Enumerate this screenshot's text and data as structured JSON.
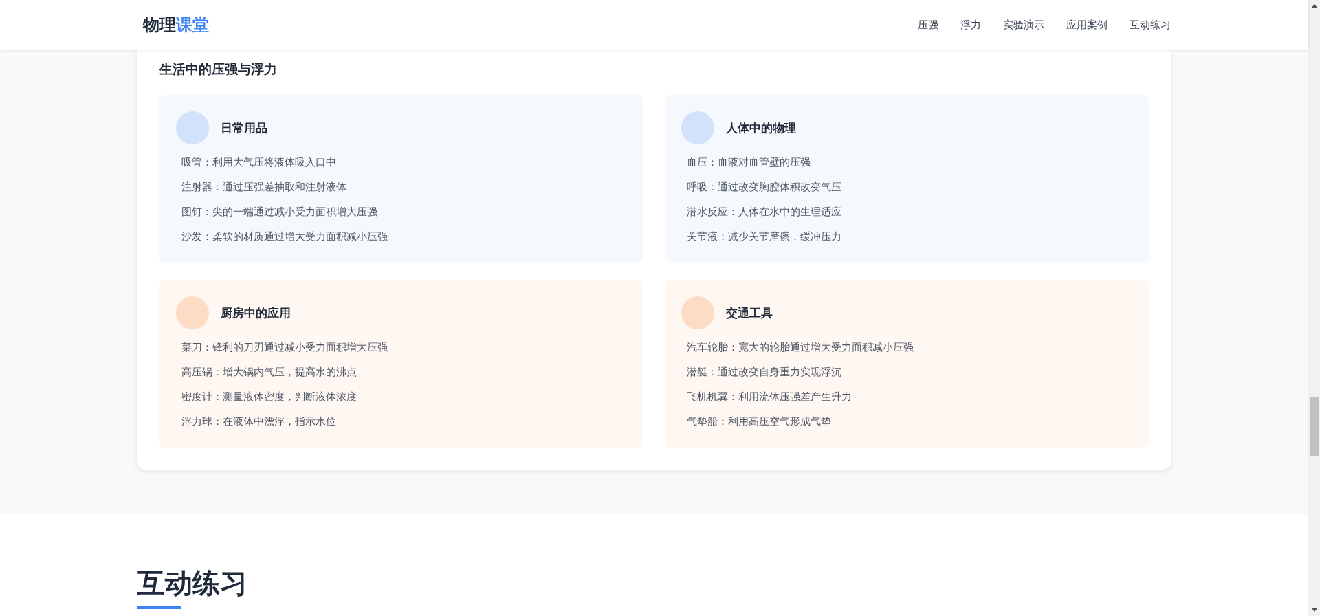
{
  "logo": {
    "part_1": "物理",
    "part_2": "课堂"
  },
  "nav": [
    "压强",
    "浮力",
    "实验演示",
    "应用案例",
    "互动练习"
  ],
  "life_section": {
    "title": "生活中的压强与浮力",
    "cards": [
      {
        "title": "日常用品",
        "color": "#d2e2fb",
        "items": [
          "吸管：利用大气压将液体吸入口中",
          "注射器：通过压强差抽取和注射液体",
          "图钉：尖的一端通过减小受力面积增大压强",
          "沙发：柔软的材质通过增大受力面积减小压强"
        ]
      },
      {
        "title": "人体中的物理",
        "color": "#d2e2fb",
        "items": [
          "血压：血液对血管壁的压强",
          "呼吸：通过改变胸腔体积改变气压",
          "潜水反应：人体在水中的生理适应",
          "关节液：减少关节摩擦，缓冲压力"
        ]
      },
      {
        "title": "厨房中的应用",
        "color": "#fddcc6",
        "items": [
          "菜刀：锋利的刀刃通过减小受力面积增大压强",
          "高压锅：增大锅内气压，提高水的沸点",
          "密度计：测量液体密度，判断液体浓度",
          "浮力球：在液体中漂浮，指示水位"
        ]
      },
      {
        "title": "交通工具",
        "color": "#fddcc6",
        "items": [
          "汽车轮胎：宽大的轮胎通过增大受力面积减小压强",
          "潜艇：通过改变自身重力实现浮沉",
          "飞机机翼：利用流体压强差产生升力",
          "气垫船：利用高压空气形成气垫"
        ]
      }
    ]
  },
  "practice_section": {
    "title": "互动练习"
  }
}
